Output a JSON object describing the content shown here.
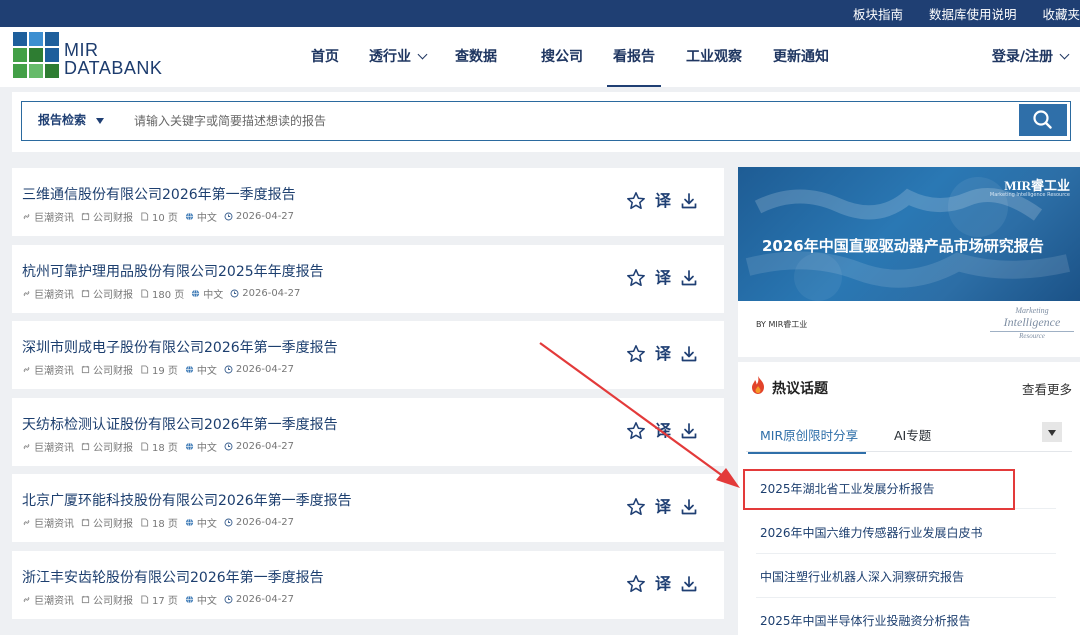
{
  "topbar": {
    "links": [
      "板块指南",
      "数据库使用说明",
      "收藏夹"
    ]
  },
  "logo": {
    "line1": "MIR",
    "line2": "DATABANK"
  },
  "nav": {
    "items": [
      {
        "label": "首页"
      },
      {
        "label": "透行业"
      },
      {
        "label": "查数据"
      },
      {
        "label": "搜公司"
      },
      {
        "label": "看报告"
      },
      {
        "label": "工业观察"
      },
      {
        "label": "更新通知"
      }
    ],
    "login": "登录/注册"
  },
  "search": {
    "scope": "报告检索",
    "placeholder": "请输入关键字或简要描述想读的报告"
  },
  "reports": [
    {
      "title": "三维通信股份有限公司2026年第一季度报告",
      "source": "巨潮资讯",
      "type": "公司财报",
      "pages": "10 页",
      "lang": "中文",
      "date": "2026-04-27"
    },
    {
      "title": "杭州可靠护理用品股份有限公司2025年年度报告",
      "source": "巨潮资讯",
      "type": "公司财报",
      "pages": "180 页",
      "lang": "中文",
      "date": "2026-04-27"
    },
    {
      "title": "深圳市则成电子股份有限公司2026年第一季度报告",
      "source": "巨潮资讯",
      "type": "公司财报",
      "pages": "19 页",
      "lang": "中文",
      "date": "2026-04-27"
    },
    {
      "title": "天纺标检测认证股份有限公司2026年第一季度报告",
      "source": "巨潮资讯",
      "type": "公司财报",
      "pages": "18 页",
      "lang": "中文",
      "date": "2026-04-27"
    },
    {
      "title": "北京广厦环能科技股份有限公司2026年第一季度报告",
      "source": "巨潮资讯",
      "type": "公司财报",
      "pages": "18 页",
      "lang": "中文",
      "date": "2026-04-27"
    },
    {
      "title": "浙江丰安齿轮股份有限公司2026年第一季度报告",
      "source": "巨潮资讯",
      "type": "公司财报",
      "pages": "17 页",
      "lang": "中文",
      "date": "2026-04-27"
    }
  ],
  "actions": {
    "translate": "译"
  },
  "banner": {
    "brand": "MIR睿工业",
    "brand_sub": "Marketing Intelligence Resource",
    "title": "2026年中国直驱驱动器产品市场研究报告",
    "by": "BY MIR睿工业",
    "mark_line1": "Marketing",
    "mark_line2": "Intelligence",
    "mark_line3": "Resource"
  },
  "hot": {
    "title": "热议话题",
    "more": "查看更多",
    "tabs": [
      "MIR原创限时分享",
      "AI专题"
    ],
    "items": [
      "2025年湖北省工业发展分析报告",
      "2026年中国六维力传感器行业发展白皮书",
      "中国注塑行业机器人深入洞察研究报告",
      "2025年中国半导体行业投融资分析报告"
    ]
  },
  "colors": {
    "nav_bg": "#1f3f73",
    "accent": "#2f6fa9",
    "title_text": "#1d3f6f",
    "annotation": "#e33a3a"
  }
}
